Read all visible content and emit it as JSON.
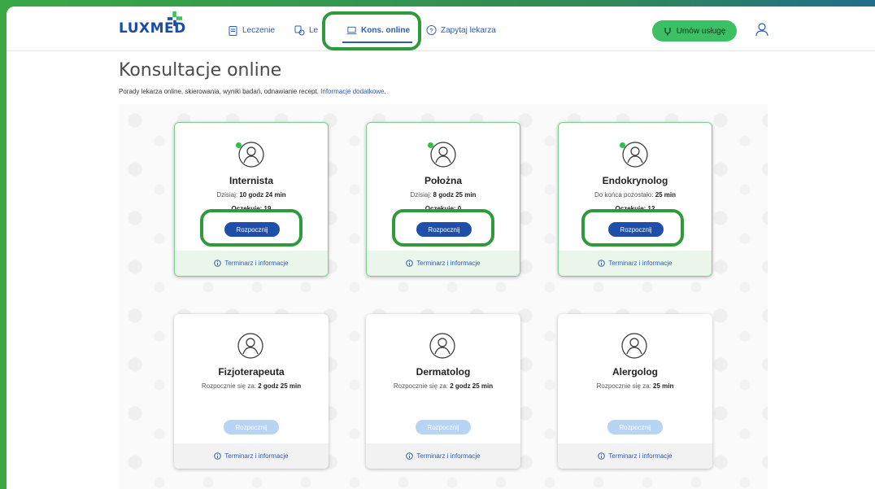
{
  "brand": {
    "logo_text": "LUXMED"
  },
  "nav": {
    "items": [
      {
        "label": "Leczenie",
        "icon": "clipboard-icon"
      },
      {
        "label": "Le",
        "icon": "pills-icon"
      },
      {
        "label": "Kons. online",
        "icon": "laptop-icon"
      },
      {
        "label": "Zapytaj lekarza",
        "icon": "question-icon"
      }
    ],
    "active_index": 2
  },
  "actions": {
    "book_label": "Umów usługę"
  },
  "page": {
    "title": "Konsultacje online",
    "subtitle": "Porady lekarza online, skierowania, wyniki badań, odnawianie recept. ",
    "subtitle_link": "Informacje dodatkowe."
  },
  "cards": [
    {
      "name": "Internista",
      "info_prefix": "Dzisiaj: ",
      "info_value": "10 godz 24 min",
      "waiting": "Oczekuje: 19",
      "button": "Rozpocznij",
      "footer": "Terminarz i informacje"
    },
    {
      "name": "Położna",
      "info_prefix": "Dzisiaj: ",
      "info_value": "8 godz 25 min",
      "waiting": "Oczekuje: 0",
      "button": "Rozpocznij",
      "footer": "Terminarz i informacje"
    },
    {
      "name": "Endokrynolog",
      "info_prefix": "Do końca pozostało: ",
      "info_value": "25 min",
      "waiting": "Oczekuje: 12",
      "button": "Rozpocznij",
      "footer": "Terminarz i informacje"
    },
    {
      "name": "Fizjoterapeuta",
      "info_prefix": "Rozpocznie się za: ",
      "info_value": "2 godz 25 min",
      "waiting": "",
      "button": "Rozpocznij",
      "footer": "Terminarz i informacje"
    },
    {
      "name": "Dermatolog",
      "info_prefix": "Rozpocznie się za: ",
      "info_value": "2 godz 25 min",
      "waiting": "",
      "button": "Rozpocznij",
      "footer": "Terminarz i informacje"
    },
    {
      "name": "Alergolog",
      "info_prefix": "Rozpocznie się za: ",
      "info_value": "25 min",
      "waiting": "",
      "button": "Rozpocznij",
      "footer": "Terminarz i informacje"
    }
  ],
  "colors": {
    "brand_blue": "#1f4fa8",
    "accent_green": "#3cc063",
    "highlight_green": "#2e9a3c"
  }
}
